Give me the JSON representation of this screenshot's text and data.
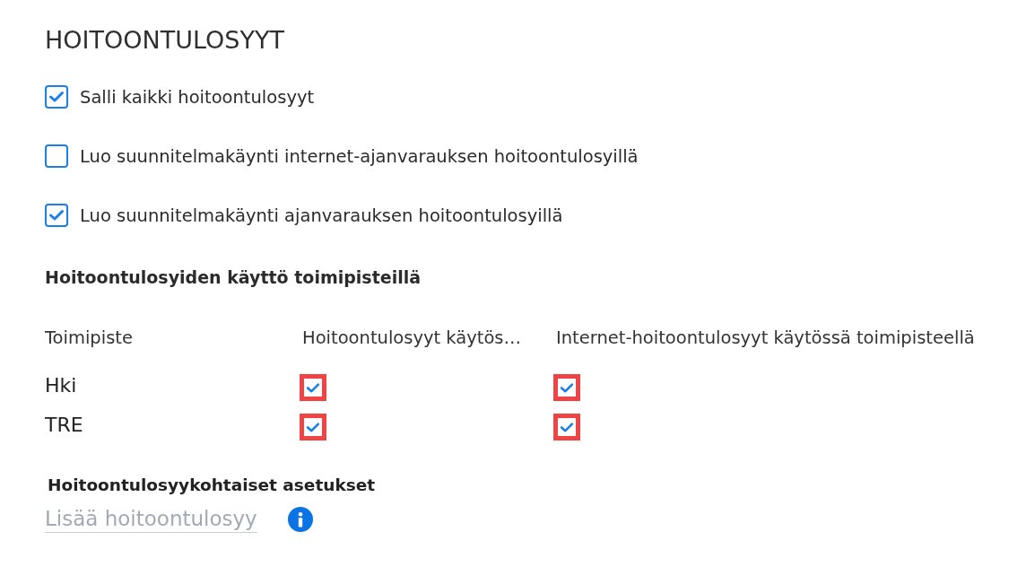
{
  "heading": "HOITOONTULOSYYT",
  "options": [
    {
      "label": "Salli kaikki hoitoontulosyyt",
      "checked": true
    },
    {
      "label": "Luo suunnitelmakäynti internet-ajanvarauksen hoitoontulosyillä",
      "checked": false
    },
    {
      "label": "Luo suunnitelmakäynti ajanvarauksen hoitoontulosyillä",
      "checked": true
    }
  ],
  "units_section": {
    "title": "Hoitoontulosyiden käyttö toimipisteillä",
    "columns": [
      "Toimipiste",
      "Hoitoontulosyyt käytös…",
      "Internet-hoitoontulosyyt käytössä toimipisteellä"
    ],
    "rows": [
      {
        "name": "Hki",
        "in_use": {
          "checked": true,
          "highlighted": true
        },
        "internet_in_use": {
          "checked": true,
          "highlighted": true
        }
      },
      {
        "name": "TRE",
        "in_use": {
          "checked": true,
          "highlighted": true
        },
        "internet_in_use": {
          "checked": true,
          "highlighted": true
        }
      }
    ]
  },
  "reason_settings": {
    "title": "Hoitoontulosyykohtaiset asetukset",
    "add_link": "Lisää hoitoontulosyy"
  }
}
